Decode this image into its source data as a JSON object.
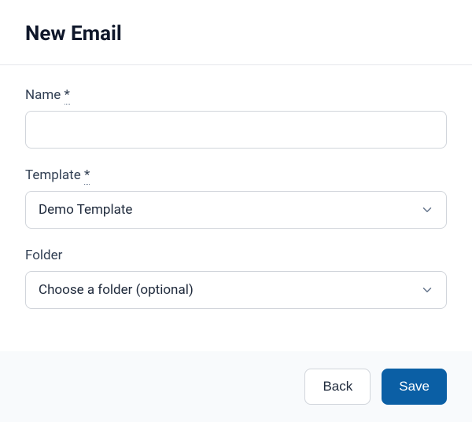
{
  "header": {
    "title": "New Email"
  },
  "form": {
    "name": {
      "label": "Name",
      "required_mark": "*",
      "value": ""
    },
    "template": {
      "label": "Template",
      "required_mark": "*",
      "selected": "Demo Template"
    },
    "folder": {
      "label": "Folder",
      "selected": "Choose a folder (optional)"
    }
  },
  "footer": {
    "back_label": "Back",
    "save_label": "Save"
  }
}
